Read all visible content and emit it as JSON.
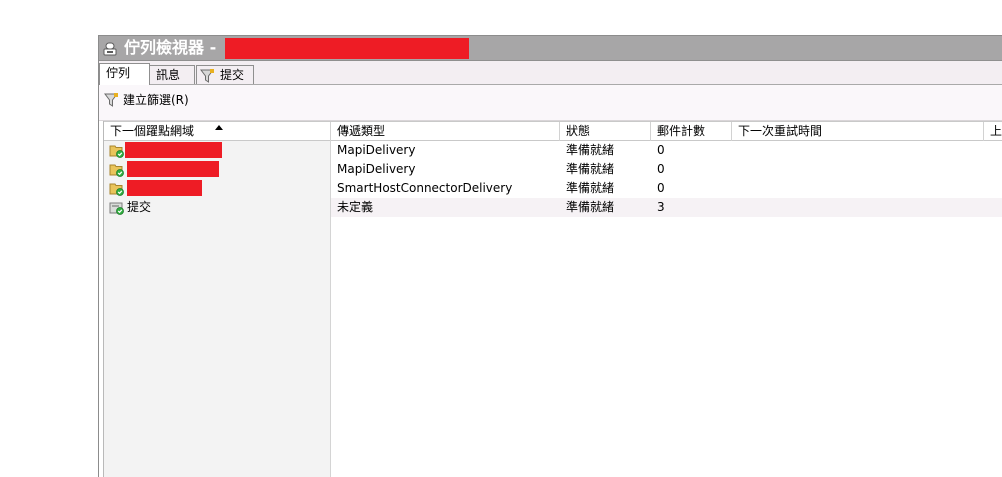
{
  "window": {
    "title": "佇列檢視器 -"
  },
  "tabs": [
    {
      "label": "佇列",
      "active": true
    },
    {
      "label": "訊息",
      "active": false
    },
    {
      "label": "提交",
      "active": false,
      "icon": "filter-icon"
    }
  ],
  "toolbar": {
    "create_filter_label": "建立篩選(R)"
  },
  "table": {
    "columns": [
      "下一個躍點網域",
      "傳遞類型",
      "狀態",
      "郵件計數",
      "下一次重試時間",
      "上"
    ],
    "sorted_column": "下一個躍點網域",
    "rows": [
      {
        "domain": "",
        "redacted": true,
        "delivery_type": "MapiDelivery",
        "status": "準備就緒",
        "message_count": "0",
        "next_retry": ""
      },
      {
        "domain": "",
        "redacted": true,
        "delivery_type": "MapiDelivery",
        "status": "準備就緒",
        "message_count": "0",
        "next_retry": ""
      },
      {
        "domain": "",
        "redacted": true,
        "delivery_type": "SmartHostConnectorDelivery",
        "status": "準備就緒",
        "message_count": "0",
        "next_retry": ""
      },
      {
        "domain": "提交",
        "redacted": false,
        "delivery_type": "未定義",
        "status": "準備就緒",
        "message_count": "3",
        "next_retry": ""
      }
    ]
  },
  "colors": {
    "titlebar": "#a7a6a7",
    "redaction": "#ee1c25",
    "tab_strip": "#f3eef2",
    "left_pane": "#f3f3f3"
  }
}
